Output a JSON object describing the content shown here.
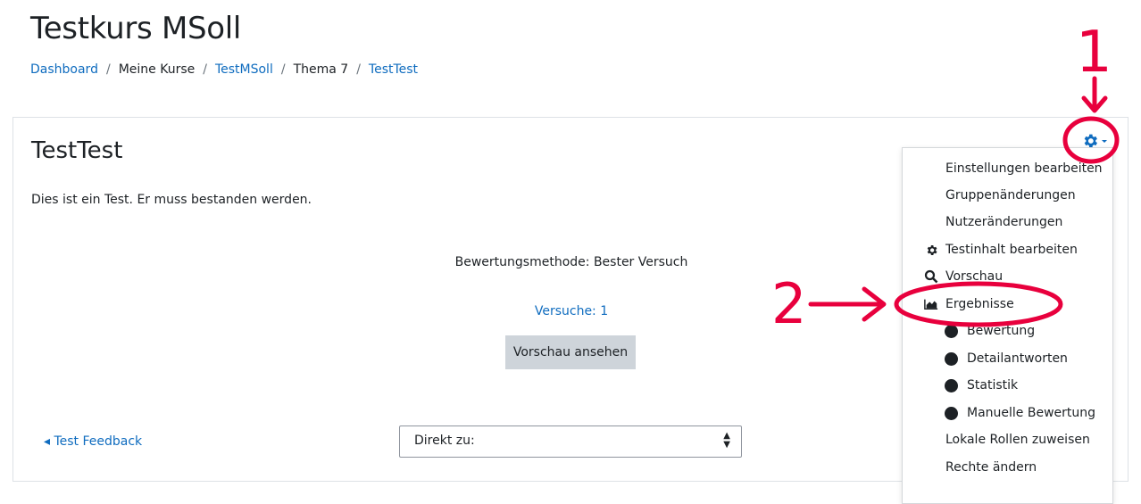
{
  "course_title": "Testkurs MSoll",
  "breadcrumb": [
    {
      "label": "Dashboard",
      "link": true
    },
    {
      "label": "Meine Kurse",
      "link": false
    },
    {
      "label": "TestMSoll",
      "link": true
    },
    {
      "label": "Thema 7",
      "link": false
    },
    {
      "label": "TestTest",
      "link": true
    }
  ],
  "breadcrumb_separator": "/",
  "activity": {
    "title": "TestTest",
    "intro": "Dies ist ein Test. Er muss bestanden werden.",
    "grading_method": "Bewertungsmethode: Bester Versuch",
    "attempts_link": "Versuche: 1",
    "preview_button": "Vorschau ansehen",
    "prev_activity_link": "◂ Test Feedback",
    "jump_to": "Direkt zu:"
  },
  "settings_menu": {
    "icon": "gear-icon",
    "items": [
      {
        "label": "Einstellungen bearbeiten",
        "icon": null,
        "sub": false
      },
      {
        "label": "Gruppenänderungen",
        "icon": null,
        "sub": false
      },
      {
        "label": "Nutzeränderungen",
        "icon": null,
        "sub": false
      },
      {
        "label": "Testinhalt bearbeiten",
        "icon": "gear-icon",
        "sub": false
      },
      {
        "label": "Vorschau",
        "icon": "magnifier-icon",
        "sub": false
      },
      {
        "label": "Ergebnisse",
        "icon": "area-chart-icon",
        "sub": false
      },
      {
        "label": "Bewertung",
        "icon": "dot",
        "sub": true
      },
      {
        "label": "Detailantworten",
        "icon": "dot",
        "sub": true
      },
      {
        "label": "Statistik",
        "icon": "dot",
        "sub": true
      },
      {
        "label": "Manuelle Bewertung",
        "icon": "dot",
        "sub": true
      },
      {
        "label": "Lokale Rollen zuweisen",
        "icon": null,
        "sub": false
      },
      {
        "label": "Rechte ändern",
        "icon": null,
        "sub": false
      }
    ]
  },
  "annotations": {
    "label_1": "1",
    "label_2": "2",
    "color": "#e8003d"
  },
  "colors": {
    "link": "#0f6cbf",
    "text": "#1d2125",
    "button_bg": "#ced4da"
  }
}
